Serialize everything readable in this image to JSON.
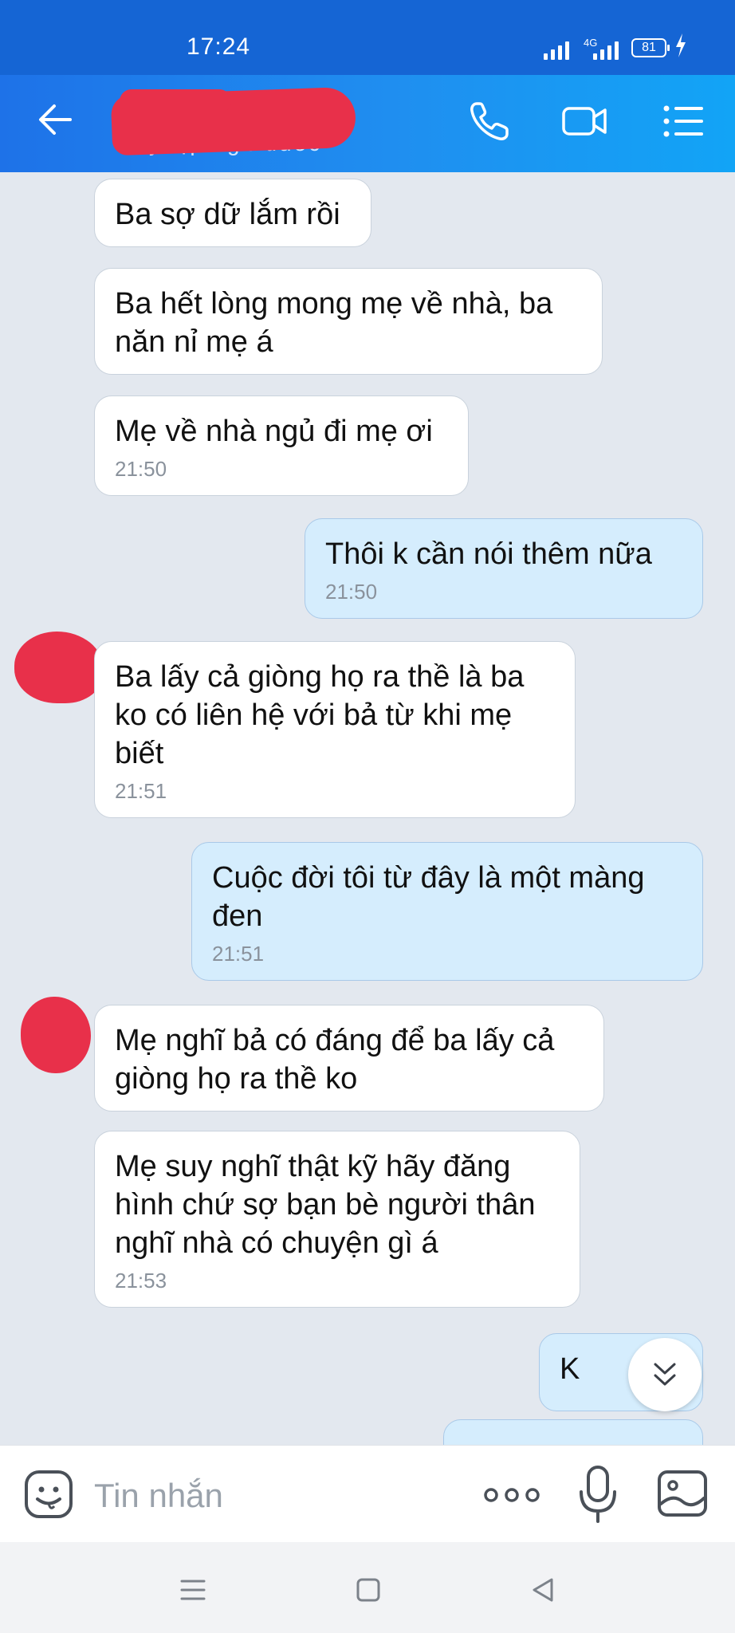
{
  "status_bar": {
    "time": "17:24",
    "network": "4G",
    "battery": "81"
  },
  "header": {
    "contact_name": "",
    "subtitle": "Truy cập 3 giờ trước"
  },
  "messages": [
    {
      "side": "in",
      "text": "Ba sợ dữ lắm rồi",
      "time": ""
    },
    {
      "side": "in",
      "text": "Ba hết lòng mong mẹ về nhà, ba năn nỉ mẹ á",
      "time": ""
    },
    {
      "side": "in",
      "text": "Mẹ về nhà ngủ đi mẹ ơi",
      "time": "21:50"
    },
    {
      "side": "out",
      "text": "Thôi k cần nói thêm nữa",
      "time": "21:50"
    },
    {
      "side": "in",
      "text": "Ba lấy cả giòng họ ra thề là ba ko có liên hệ với bả từ khi mẹ biết",
      "time": "21:51"
    },
    {
      "side": "out",
      "text": "Cuộc đời tôi từ đây là một màng đen",
      "time": "21:51"
    },
    {
      "side": "in",
      "text": "Mẹ nghĩ bả có đáng để ba lấy cả giòng họ ra thề ko",
      "time": ""
    },
    {
      "side": "in",
      "text": "Mẹ suy nghĩ thật kỹ hãy đăng hình chứ sợ bạn bè người thân nghĩ nhà có chuyện gì á",
      "time": "21:53"
    },
    {
      "side": "out",
      "text": "K",
      "time": ""
    }
  ],
  "input": {
    "placeholder": "Tin nhắn"
  },
  "icons": {
    "header": [
      "back-icon",
      "call-icon",
      "video-icon",
      "menu-icon"
    ],
    "input": [
      "sticker-icon",
      "more-icon",
      "mic-icon",
      "image-icon"
    ],
    "nav": [
      "nav-menu-icon",
      "nav-home-icon",
      "nav-back-icon"
    ]
  },
  "colors": {
    "header_gradient_start": "#1e72e8",
    "header_gradient_end": "#12a4f6",
    "chat_background": "#e3e8ef",
    "incoming_bubble": "#ffffff",
    "outgoing_bubble": "#d5edfd",
    "redaction": "#e8304a"
  }
}
